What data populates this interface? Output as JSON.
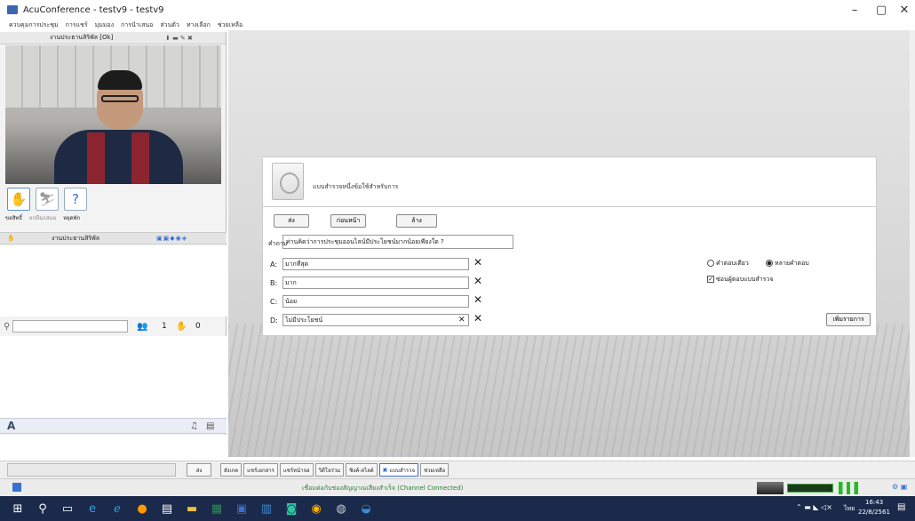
{
  "window": {
    "title": "AcuConference - testv9 - testv9"
  },
  "menu": [
    "ควบคุมการประชุม",
    "การแชร์",
    "มุมมอง",
    "การนำเสนอ",
    "ส่วนตัว",
    "ทางเลือก",
    "ช่วยเหลือ"
  ],
  "left": {
    "video_header": "งานประธานสิริพัล [Ok]",
    "status_labels": [
      "ขอสิทธิ์",
      "ยกมือ/เสนอ",
      "หยุดพัก"
    ],
    "list_header": "งานประธานสิริพัล",
    "participant_count": "1",
    "hand_count": "0",
    "font_label": "A"
  },
  "poll": {
    "title": "แบบสำรวจหนึ่งข้อใช้สำหรับการ",
    "btn_send": "ส่ง",
    "btn_prev": "ก่อนหน้า",
    "btn_clear": "ล้าง",
    "question_label": "คำถาม",
    "question": "ท่านคิดว่าการประชุมออนไลน์มีประโยชน์มากน้อยเพียงใด ?",
    "options": [
      {
        "label": "A:",
        "value": "มากที่สุด"
      },
      {
        "label": "B:",
        "value": "มาก"
      },
      {
        "label": "C:",
        "value": "น้อย"
      },
      {
        "label": "D:",
        "value": "ไม่มีประโยชน์"
      }
    ],
    "radio_single": "คำตอบเดียว",
    "radio_multi": "หลายคำตอบ",
    "checkbox_label": "ซ่อนผู้ตอบแบบสำรวจ",
    "add_button": "เพิ่มรายการ"
  },
  "bottom_tabs": [
    "ส่ง",
    "สังเกต",
    "แชร์เอกสาร",
    "แชร์หน้าจอ",
    "วิดีโอร่วม",
    "ซิงค์-สไลด์",
    "แบบสำรวจ",
    "ช่วยเหลือ"
  ],
  "status": {
    "text": "เชื่อมต่อกับช่องสัญญาณเสียงสำเร็จ (Channel Connected)"
  },
  "taskbar": {
    "time": "16:43",
    "date": "22/8/2561",
    "lang": "ไทย"
  }
}
